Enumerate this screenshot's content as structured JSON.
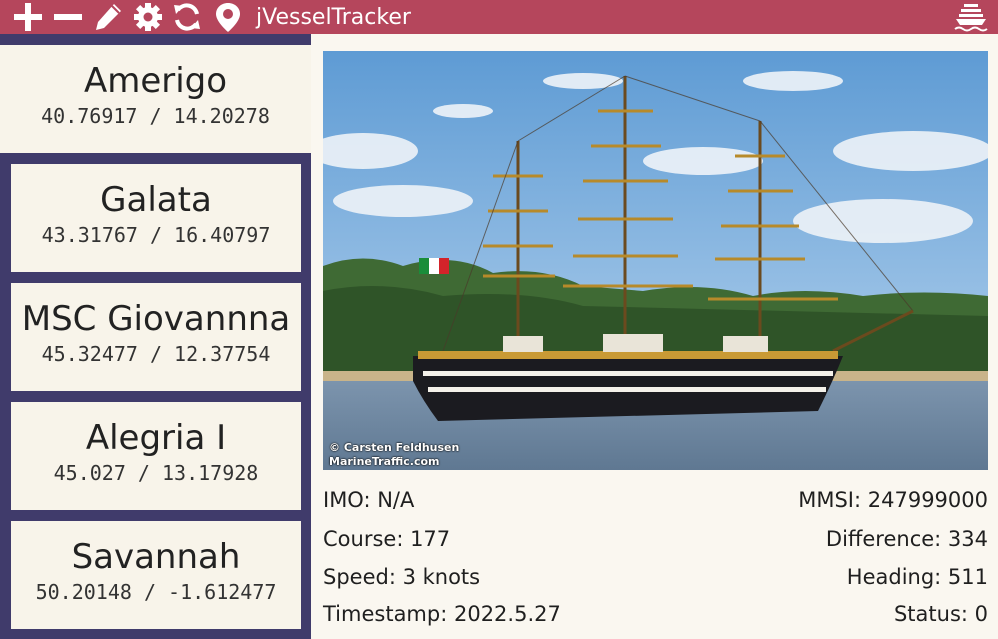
{
  "app": {
    "title": "jVesselTracker",
    "toolbar_icons": [
      "plus-icon",
      "minus-icon",
      "pencil-icon",
      "gear-icon",
      "refresh-icon",
      "map-pin-icon",
      "ship-icon"
    ],
    "accent_color": "#b5465c",
    "sidebar_color": "#403b6b"
  },
  "vessels": [
    {
      "name": "Amerigo",
      "coords": "40.76917 / 14.20278",
      "selected": true
    },
    {
      "name": "Galata",
      "coords": "43.31767 / 16.40797"
    },
    {
      "name": "MSC Giovannna",
      "coords": "45.32477 / 12.37754"
    },
    {
      "name": "Alegria I",
      "coords": "45.027 / 13.17928"
    },
    {
      "name": "Savannah",
      "coords": "50.20148 / -1.612477"
    }
  ],
  "photo": {
    "credit_line1": "© Carsten Feldhusen",
    "credit_line2": "MarineTraffic.com"
  },
  "details": {
    "imo": "IMO: N/A",
    "course": "Course: 177",
    "speed": "Speed: 3 knots",
    "timestamp": "Timestamp: 2022.5.27",
    "mmsi": "MMSI: 247999000",
    "difference": "Difference: 334",
    "heading": "Heading: 511",
    "status": "Status: 0"
  }
}
